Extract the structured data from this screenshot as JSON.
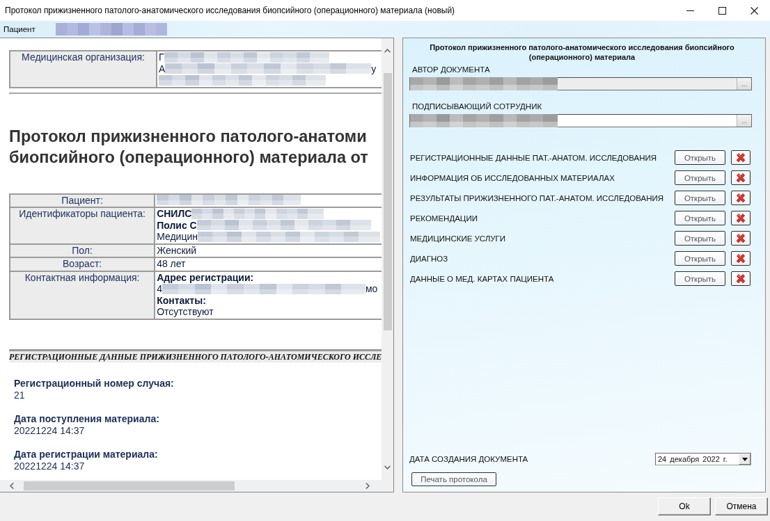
{
  "window": {
    "title": "Протокол прижизненного патолого-анатомического исследования биопсийного (операционного) материала (новый)"
  },
  "patient_bar": {
    "label": "Пациент",
    "redacted": true
  },
  "document": {
    "organization_table": [
      {
        "label": "Медицинская организация:",
        "lines": [
          {
            "text": "Г",
            "redacted": true
          },
          {
            "text": "А",
            "redacted": true,
            "text_after": "у"
          },
          {
            "redacted": true
          }
        ]
      }
    ],
    "heading_lines": [
      "Протокол прижизненного патолого-анатоми",
      "биопсийного (операционного) материала от"
    ],
    "patient_table": [
      {
        "label": "Пациент:",
        "lines": [
          {
            "redacted": true
          }
        ]
      },
      {
        "label": "Идентификаторы пациента:",
        "lines": [
          {
            "bold": true,
            "text": "СНИЛС",
            "redacted": true
          },
          {
            "bold": true,
            "text": "Полис С",
            "redacted": true
          },
          {
            "text": "Медицин",
            "redacted": true
          }
        ]
      },
      {
        "label": "Пол:",
        "lines": [
          {
            "text": "Женский"
          }
        ]
      },
      {
        "label": "Возраст:",
        "lines": [
          {
            "text": "48 лет"
          }
        ]
      },
      {
        "label": "Контактная информация:",
        "lines": [
          {
            "bold": true,
            "text": "Адрес регистрации:"
          },
          {
            "text": "4",
            "redacted": true,
            "text_after": "мо"
          },
          {
            "bold": true,
            "text": "Контакты:"
          },
          {
            "text": "Отсутствуют"
          }
        ]
      }
    ],
    "section_title": "РЕГИСТРАЦИОННЫЕ ДАННЫЕ ПРИЖИЗНЕННОГО ПАТОЛОГО-АНАТОМИЧЕСКОГО ИССЛЕ",
    "fields": [
      {
        "label": "Регистрационный номер случая:",
        "value": "21"
      },
      {
        "label": "Дата поступления материала:",
        "value": "20221224 14:37"
      },
      {
        "label": "Дата регистрации материала:",
        "value": "20221224 14:37"
      }
    ]
  },
  "form": {
    "title": "Протокол прижизненного патолого-анатомического исследования биопсийного (операционного) материала",
    "author": {
      "label": "АВТОР ДОКУМЕНТА",
      "redacted": true,
      "disabled": true,
      "browse_label": "..."
    },
    "signer": {
      "label": "ПОДПИСЫВАЮЩИЙ СОТРУДНИК",
      "redacted": true,
      "disabled": false,
      "browse_label": "..."
    },
    "sections": [
      {
        "label": "РЕГИСТРАЦИОННЫЕ ДАННЫЕ ПАТ.-АНАТОМ. ИССЛЕДОВАНИЯ",
        "open_label": "Открыть"
      },
      {
        "label": "ИНФОРМАЦИЯ ОБ ИССЛЕДОВАННЫХ МАТЕРИАЛАХ",
        "open_label": "Открыть"
      },
      {
        "label": "РЕЗУЛЬТАТЫ ПРИЖИЗНЕННОГО ПАТ.-АНАТОМ. ИССЛЕДОВАНИЯ",
        "open_label": "Открыть"
      },
      {
        "label": "РЕКОМЕНДАЦИИ",
        "open_label": "Открыть"
      },
      {
        "label": "МЕДИЦИНСКИЕ УСЛУГИ",
        "open_label": "Открыть"
      },
      {
        "label": "ДИАГНОЗ",
        "open_label": "Открыть"
      },
      {
        "label": "ДАННЫЕ О МЕД. КАРТАХ ПАЦИЕНТА",
        "open_label": "Открыть"
      }
    ],
    "creation_date": {
      "label": "ДАТА СОЗДАНИЯ ДОКУМЕНТА",
      "value": "24 декабря 2022 г."
    },
    "print_button": "Печать протокола"
  },
  "buttons": [
    "Ok",
    "Отмена"
  ]
}
